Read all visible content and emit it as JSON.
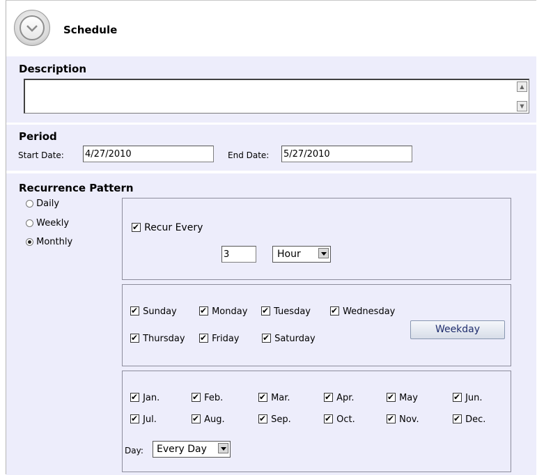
{
  "header": {
    "title": "Schedule",
    "icon": "clock-icon"
  },
  "description": {
    "label": "Description",
    "value": ""
  },
  "period": {
    "label": "Period",
    "start_label": "Start Date:",
    "start_value": "4/27/2010",
    "end_label": "End Date:",
    "end_value": "5/27/2010"
  },
  "recurrence": {
    "label": "Recurrence Pattern",
    "options": [
      {
        "label": "Daily",
        "selected": false
      },
      {
        "label": "Weekly",
        "selected": false
      },
      {
        "label": "Monthly",
        "selected": true
      }
    ],
    "recur_every": {
      "label": "Recur Every",
      "checked": true,
      "value": "3",
      "unit": "Hour"
    },
    "days": [
      {
        "label": "Sunday",
        "checked": true
      },
      {
        "label": "Monday",
        "checked": true
      },
      {
        "label": "Tuesday",
        "checked": true
      },
      {
        "label": "Wednesday",
        "checked": true
      },
      {
        "label": "Thursday",
        "checked": true
      },
      {
        "label": "Friday",
        "checked": true
      },
      {
        "label": "Saturday",
        "checked": true
      }
    ],
    "weekday_button": "Weekday",
    "months": [
      {
        "label": "Jan.",
        "checked": true
      },
      {
        "label": "Feb.",
        "checked": true
      },
      {
        "label": "Mar.",
        "checked": true
      },
      {
        "label": "Apr.",
        "checked": true
      },
      {
        "label": "May",
        "checked": true
      },
      {
        "label": "Jun.",
        "checked": true
      },
      {
        "label": "Jul.",
        "checked": true
      },
      {
        "label": "Aug.",
        "checked": true
      },
      {
        "label": "Sep.",
        "checked": true
      },
      {
        "label": "Oct.",
        "checked": true
      },
      {
        "label": "Nov.",
        "checked": true
      },
      {
        "label": "Dec.",
        "checked": true
      }
    ],
    "day_label": "Day:",
    "day_value": "Every Day"
  }
}
